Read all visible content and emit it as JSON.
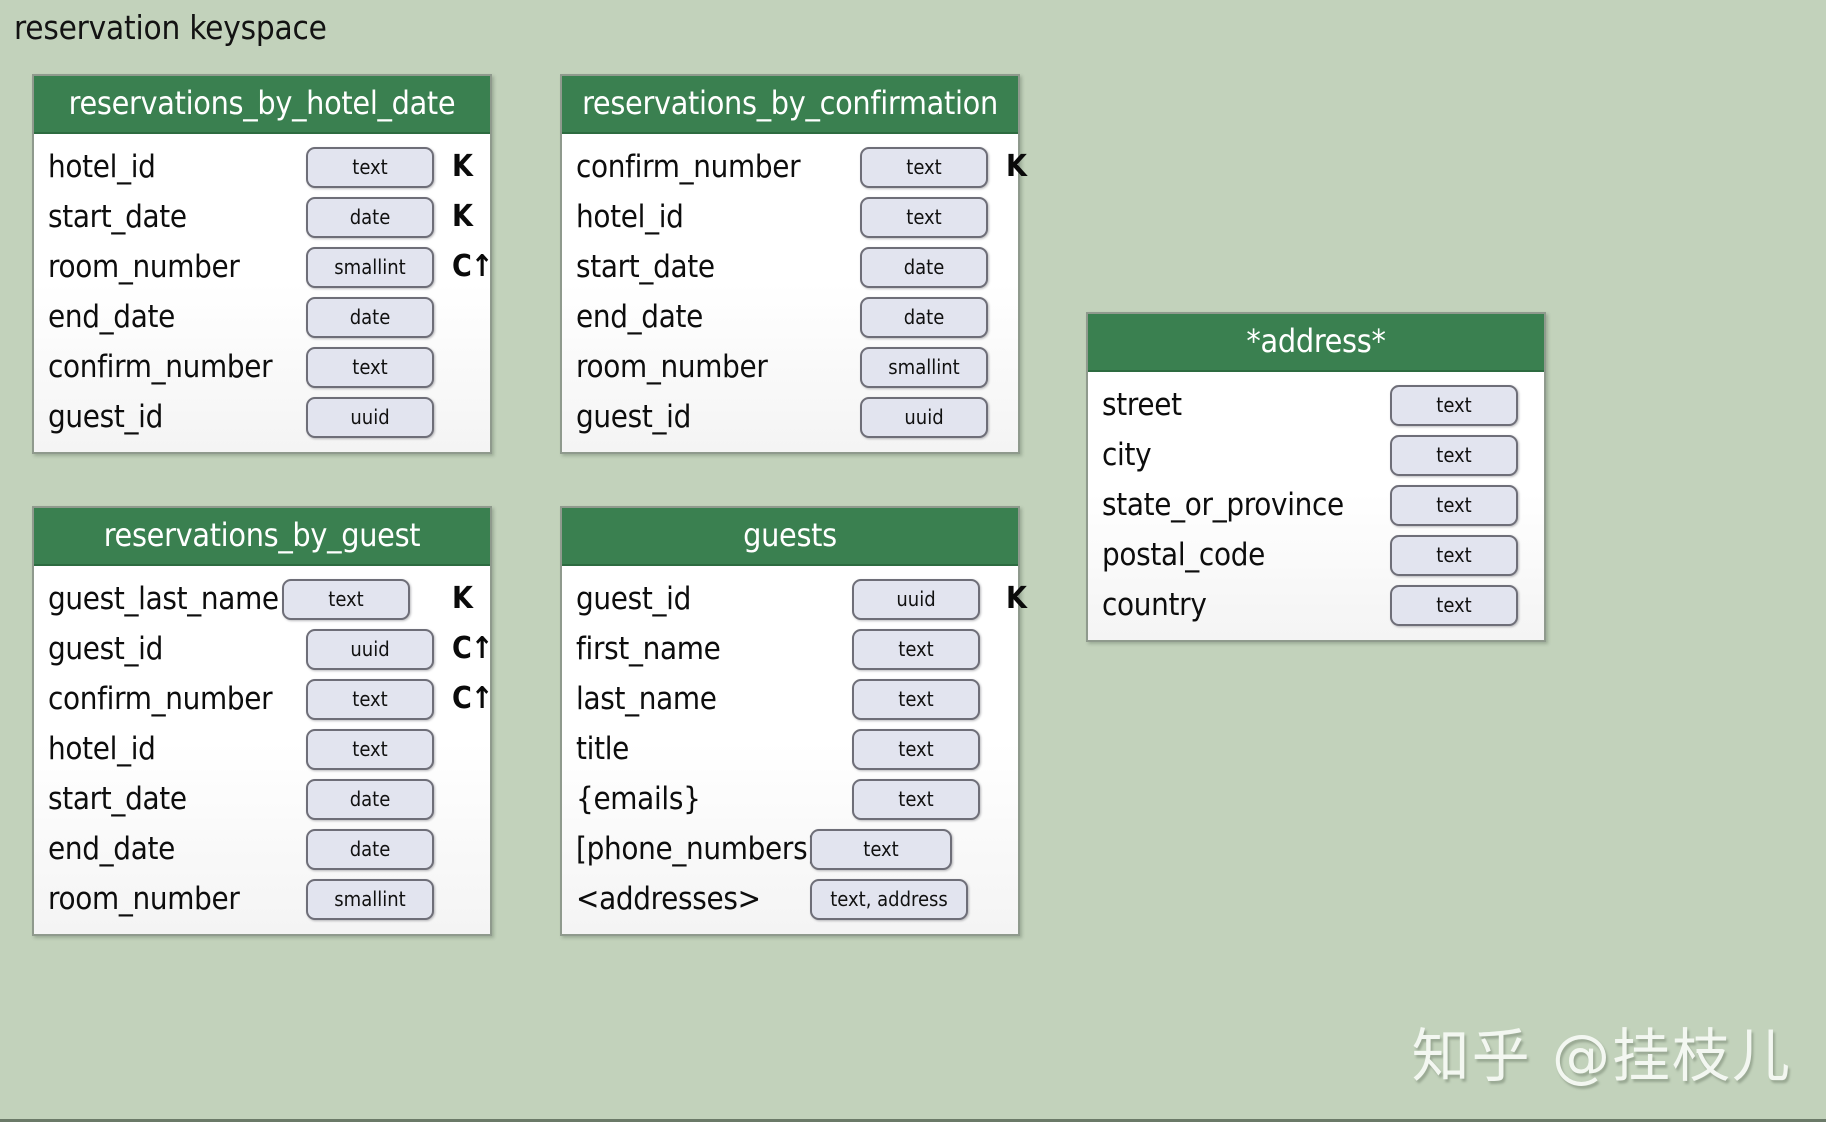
{
  "keyspace": {
    "label": "reservation keyspace"
  },
  "colors": {
    "background": "#c2d2bb",
    "header_green": "#3a8050",
    "pill_fill": "#e2e4ef",
    "pill_border": "#6e6e78",
    "card_border": "#8f9a8d",
    "body_fill": "#ffffff",
    "text": "#0d0d0d",
    "header_text": "#ffffff",
    "watermark_text": "#f3f7f1"
  },
  "tables": [
    {
      "name": "reservations_by_hotel_date",
      "columns": [
        {
          "name": "hotel_id",
          "type": "text",
          "key": "K"
        },
        {
          "name": "start_date",
          "type": "date",
          "key": "K"
        },
        {
          "name": "room_number",
          "type": "smallint",
          "key": "C↑"
        },
        {
          "name": "end_date",
          "type": "date",
          "key": ""
        },
        {
          "name": "confirm_number",
          "type": "text",
          "key": ""
        },
        {
          "name": "guest_id",
          "type": "uuid",
          "key": ""
        }
      ]
    },
    {
      "name": "reservations_by_confirmation",
      "columns": [
        {
          "name": "confirm_number",
          "type": "text",
          "key": "K"
        },
        {
          "name": "hotel_id",
          "type": "text",
          "key": ""
        },
        {
          "name": "start_date",
          "type": "date",
          "key": ""
        },
        {
          "name": "end_date",
          "type": "date",
          "key": ""
        },
        {
          "name": "room_number",
          "type": "smallint",
          "key": ""
        },
        {
          "name": "guest_id",
          "type": "uuid",
          "key": ""
        }
      ]
    },
    {
      "name": "reservations_by_guest",
      "columns": [
        {
          "name": "guest_last_name",
          "type": "text",
          "key": "K"
        },
        {
          "name": "guest_id",
          "type": "uuid",
          "key": "C↑"
        },
        {
          "name": "confirm_number",
          "type": "text",
          "key": "C↑"
        },
        {
          "name": "hotel_id",
          "type": "text",
          "key": ""
        },
        {
          "name": "start_date",
          "type": "date",
          "key": ""
        },
        {
          "name": "end_date",
          "type": "date",
          "key": ""
        },
        {
          "name": "room_number",
          "type": "smallint",
          "key": ""
        }
      ]
    },
    {
      "name": "guests",
      "columns": [
        {
          "name": "guest_id",
          "type": "uuid",
          "key": "K"
        },
        {
          "name": "first_name",
          "type": "text",
          "key": ""
        },
        {
          "name": "last_name",
          "type": "text",
          "key": ""
        },
        {
          "name": "title",
          "type": "text",
          "key": ""
        },
        {
          "name": "{emails}",
          "type": "text",
          "key": ""
        },
        {
          "name": "[phone_numbers]",
          "type": "text",
          "key": ""
        },
        {
          "name": "<addresses>",
          "type": "text, address",
          "key": ""
        }
      ]
    },
    {
      "name": "*address*",
      "columns": [
        {
          "name": "street",
          "type": "text",
          "key": ""
        },
        {
          "name": "city",
          "type": "text",
          "key": ""
        },
        {
          "name": "state_or_province",
          "type": "text",
          "key": ""
        },
        {
          "name": "postal_code",
          "type": "text",
          "key": ""
        },
        {
          "name": "country",
          "type": "text",
          "key": ""
        }
      ]
    }
  ],
  "watermark": {
    "text": "知乎 @挂枝儿"
  }
}
